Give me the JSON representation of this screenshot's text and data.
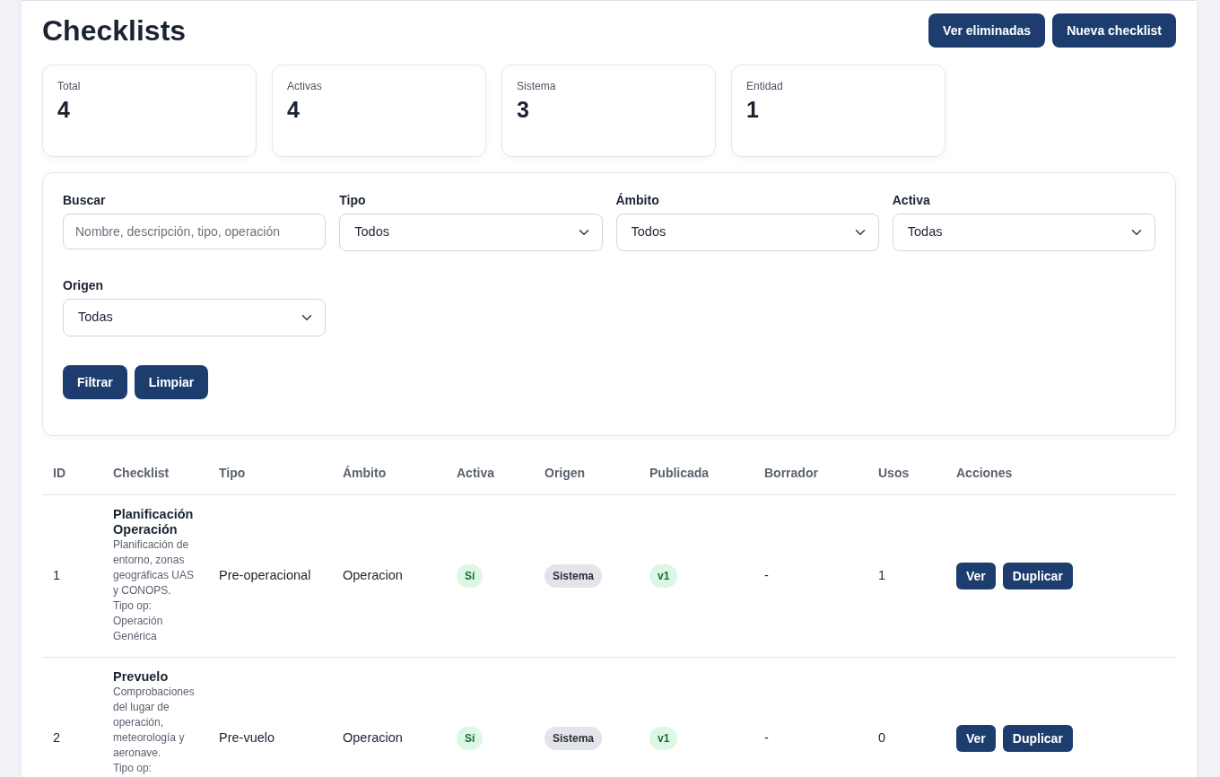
{
  "page": {
    "title": "Checklists",
    "actions": [
      "Ver eliminadas",
      "Nueva checklist"
    ]
  },
  "stats": [
    {
      "label": "Total",
      "value": "4"
    },
    {
      "label": "Activas",
      "value": "4"
    },
    {
      "label": "Sistema",
      "value": "3"
    },
    {
      "label": "Entidad",
      "value": "1"
    }
  ],
  "filters": {
    "fields": [
      {
        "label": "Buscar",
        "kind": "text",
        "placeholder": "Nombre, descripción, tipo, operación"
      },
      {
        "label": "Tipo",
        "kind": "select",
        "value": "Todos"
      },
      {
        "label": "Ámbito",
        "kind": "select",
        "value": "Todos"
      },
      {
        "label": "Activa",
        "kind": "select",
        "value": "Todas"
      },
      {
        "label": "Origen",
        "kind": "select",
        "value": "Todas"
      }
    ],
    "buttons": [
      "Filtrar",
      "Limpiar"
    ]
  },
  "table": {
    "columns": [
      "ID",
      "Checklist",
      "Tipo",
      "Ámbito",
      "Activa",
      "Origen",
      "Publicada",
      "Borrador",
      "Usos",
      "Acciones"
    ],
    "rows": [
      {
        "id": "1",
        "name": "Planificación Operación",
        "description": "Planificación de entorno, zonas geográficas UAS y CONOPS.",
        "op_type": "Tipo op: Operación Genérica",
        "type": "Pre-operacional",
        "scope": "Operacion",
        "active": {
          "label": "Sí",
          "on": true
        },
        "origin": {
          "label": "Sistema",
          "kind": "system"
        },
        "published": "v1",
        "draft": "-",
        "uses": "1",
        "actions": [
          "Ver",
          "Duplicar"
        ]
      },
      {
        "id": "2",
        "name": "Prevuelo",
        "description": "Comprobaciones del lugar de operación, meteorología y aeronave.",
        "op_type": "Tipo op:",
        "type": "Pre-vuelo",
        "scope": "Operacion",
        "active": {
          "label": "Sí",
          "on": true
        },
        "origin": {
          "label": "Sistema",
          "kind": "system"
        },
        "published": "v1",
        "draft": "-",
        "uses": "0",
        "actions": [
          "Ver",
          "Duplicar"
        ]
      }
    ]
  }
}
